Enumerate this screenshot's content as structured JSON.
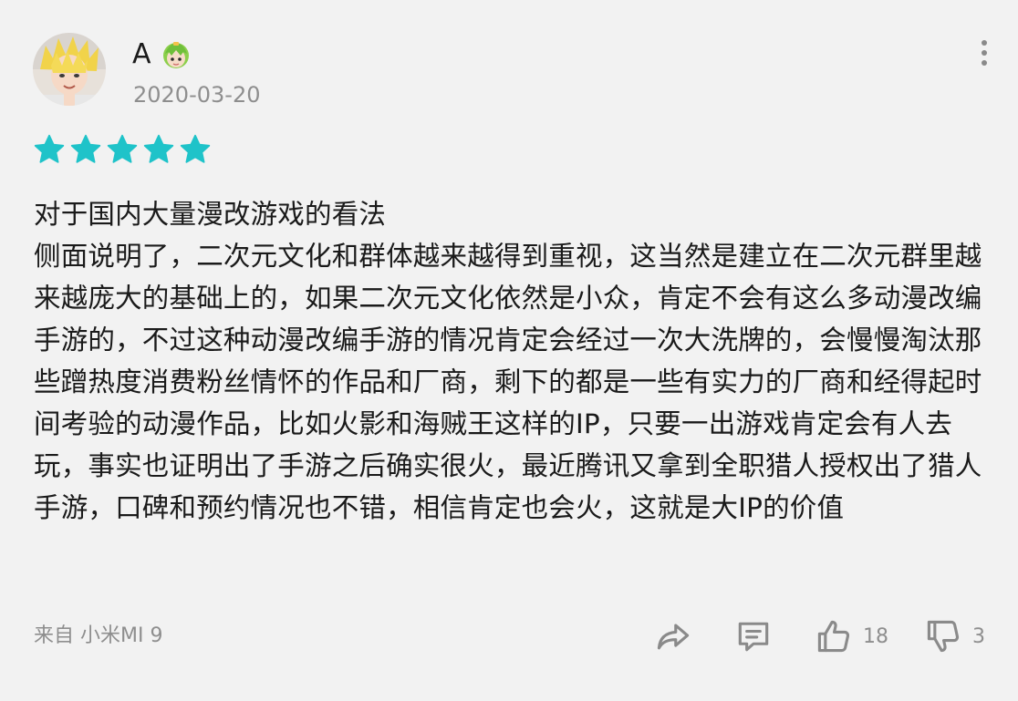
{
  "review": {
    "user": {
      "name": "A",
      "date": "2020-03-20"
    },
    "rating": 5,
    "title": "对于国内大量漫改游戏的看法",
    "body": "侧面说明了，二次元文化和群体越来越得到重视，这当然是建立在二次元群里越来越庞大的基础上的，如果二次元文化依然是小众，肯定不会有这么多动漫改编手游的，不过这种动漫改编手游的情况肯定会经过一次大洗牌的，会慢慢淘汰那些蹭热度消费粉丝情怀的作品和厂商，剩下的都是一些有实力的厂商和经得起时间考验的动漫作品，比如火影和海贼王这样的IP，只要一出游戏肯定会有人去玩，事实也证明出了手游之后确实很火，最近腾讯又拿到全职猎人授权出了猎人手游，口碑和预约情况也不错，相信肯定也会火，这就是大IP的价值",
    "device": "来自 小米MI 9",
    "likes": "18",
    "dislikes": "3"
  },
  "colors": {
    "star": "#1fc3c9",
    "meta_text": "#8e8e8e",
    "icon": "#8a8a8a",
    "background": "#f2f2f2"
  },
  "icons": {
    "share": "share-arrow-icon",
    "comment": "comment-bubble-icon",
    "like": "thumbs-up-icon",
    "dislike": "thumbs-down-icon",
    "more": "more-vertical-icon"
  }
}
